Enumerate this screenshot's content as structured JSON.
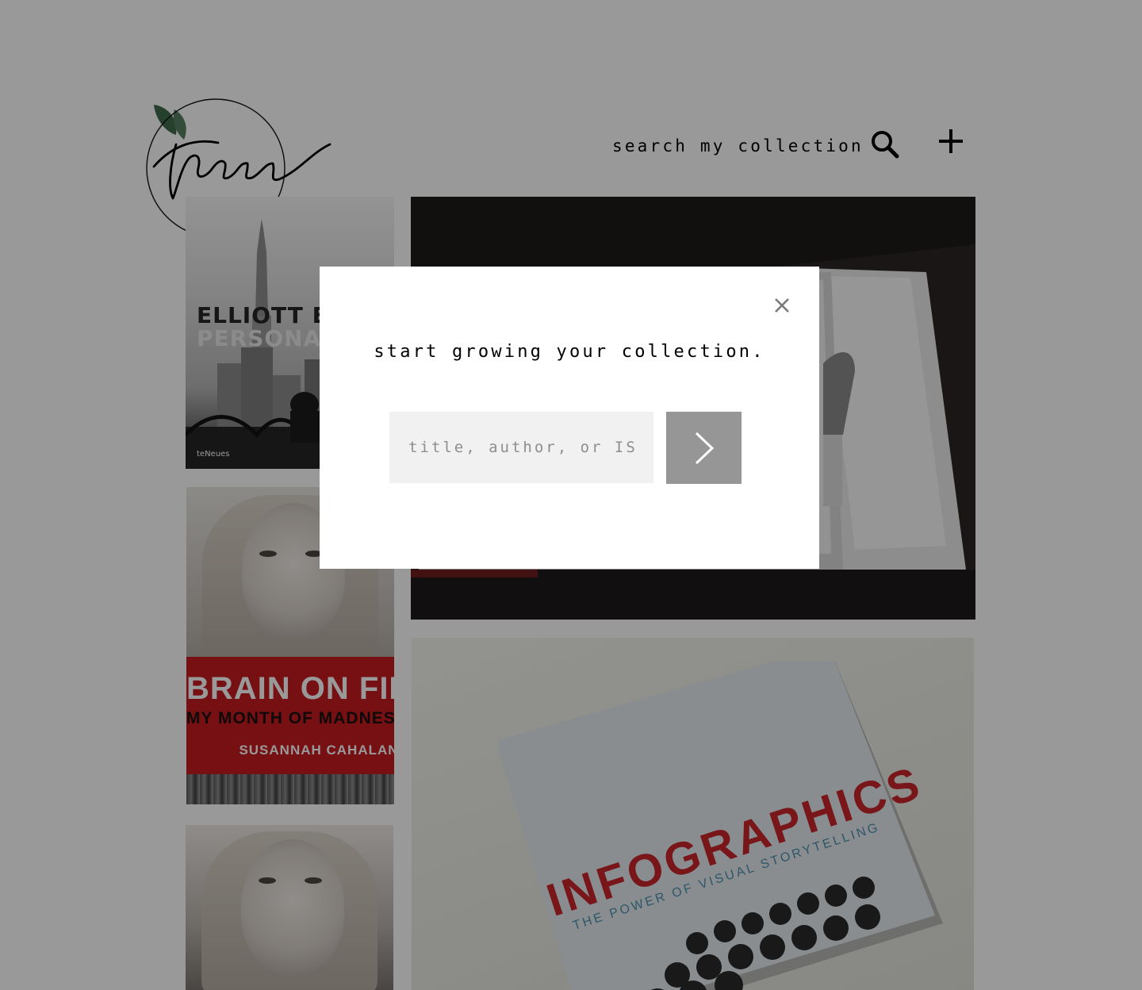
{
  "header": {
    "logo_text": "tree",
    "search_label": "search my collection",
    "search_icon": "magnifier",
    "add_icon": "plus"
  },
  "collection": {
    "books": [
      {
        "title_line1": "ELLIOTT ER",
        "title_line2": "PERSONAL",
        "publisher": "teNeues"
      },
      {
        "title": "BRAIN ON FIRE",
        "subtitle": "MY MONTH OF MADNESS",
        "author": "SUSANNAH CAHALAN"
      },
      {
        "title": "INFOGRAPHICS",
        "subtitle": "THE POWER OF VISUAL STORYTELLING"
      }
    ]
  },
  "modal": {
    "heading": "start growing your collection.",
    "input_placeholder": "title, author, or ISBN",
    "input_value": "",
    "close_icon": "close-x",
    "submit_icon": "chevron-right"
  },
  "colors": {
    "overlay": "rgba(0,0,0,0.4)",
    "modal_bg": "#ffffff",
    "input_bg": "#f1f1f1",
    "submit_bg": "#969696",
    "brain_red": "#c51b21",
    "info_red": "#c8262c",
    "leaf_green": "#3f6b4b"
  }
}
